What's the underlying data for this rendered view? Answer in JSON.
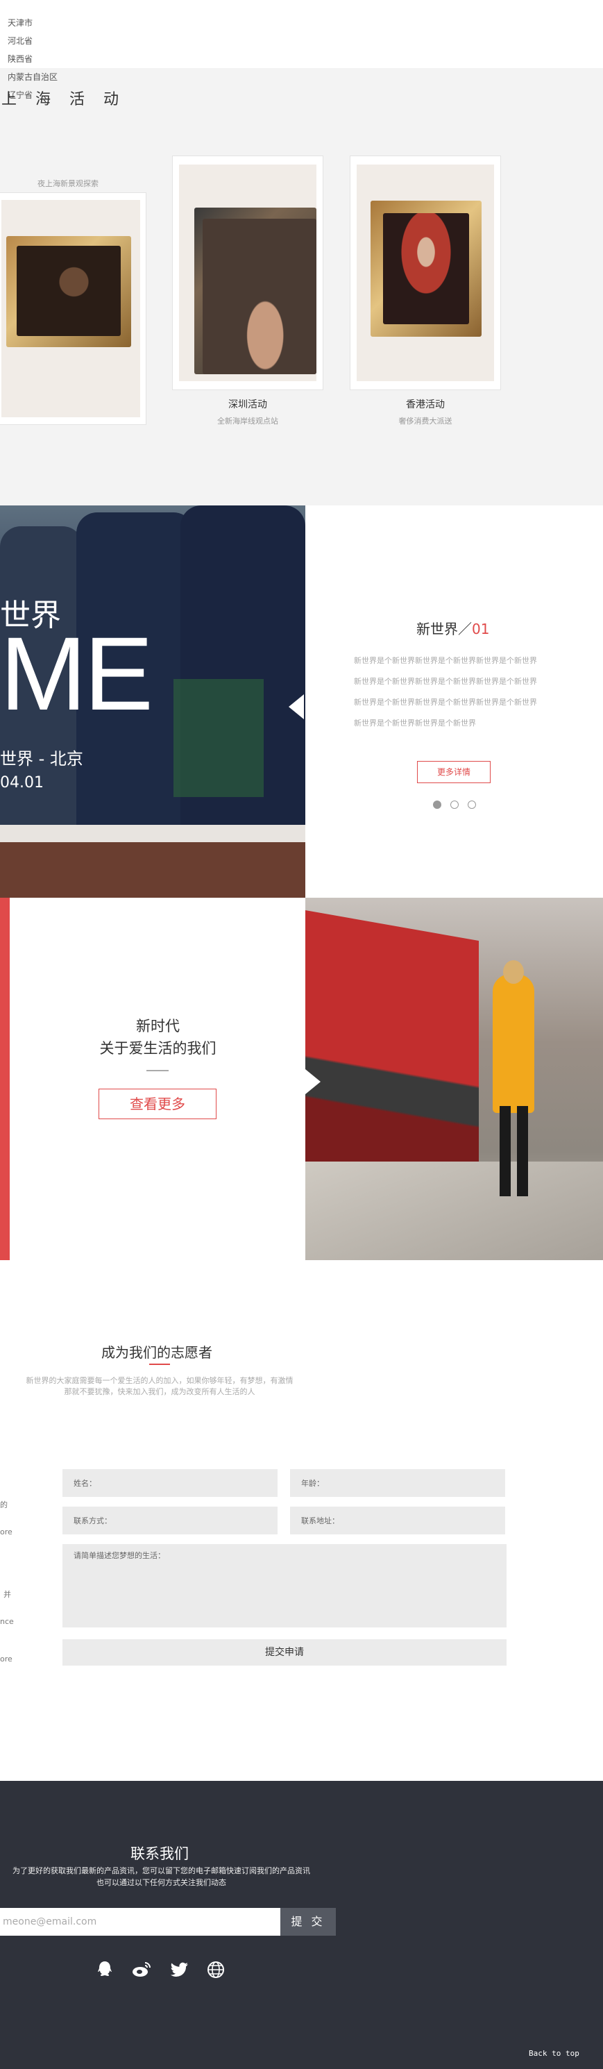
{
  "regions": [
    "天津市",
    "河北省",
    "陕西省",
    "内蒙古自治区",
    "辽宁省"
  ],
  "shanghai": {
    "title": "上海活动",
    "subtitle": "夜上海新景观探索"
  },
  "cards": [
    {
      "title": "深圳活动",
      "subtitle": "全新海岸线观点站"
    },
    {
      "title": "香港活动",
      "subtitle": "奢侈消费大派送"
    }
  ],
  "new_world": {
    "photo_world": "世界",
    "photo_me": "ME",
    "photo_place": "世界 - 北京",
    "photo_date": "04.01",
    "title": "新世界／",
    "title_num": "01",
    "lines": [
      "新世界是个新世界新世界是个新世界新世界是个新世界",
      "新世界是个新世界新世界是个新世界新世界是个新世界",
      "新世界是个新世界新世界是个新世界新世界是个新世界",
      "新世界是个新世界新世界是个新世界"
    ],
    "button": "更多详情",
    "dots": 3,
    "active_dot": 0
  },
  "new_era": {
    "title_line1": "新时代",
    "title_line2": "关于爱生活的我们",
    "button": "查看更多"
  },
  "volunteer": {
    "title": "成为我们的志愿者",
    "desc_line1": "新世界的大家庭需要每一个爱生活的人的加入，如果你够年轻，有梦想，有激情",
    "desc_line2": "那就不要犹豫，快来加入我们，成为改变所有人生活的人",
    "side_texts": [
      "的",
      "ore",
      "并",
      "nce",
      "ore"
    ],
    "fields": {
      "name": "姓名：",
      "age": "年龄：",
      "contact": "联系方式：",
      "address": "联系地址：",
      "dream": "请简单描述您梦想的生活："
    },
    "submit": "提交申请"
  },
  "footer": {
    "title": "联系我们",
    "desc_line1": "为了更好的获取我们最新的产品资讯，您可以留下您的电子邮箱快速订阅我们的产品资讯",
    "desc_line2": "也可以通过以下任何方式关注我们动态",
    "email_placeholder": "meone@email.com",
    "submit": "提 交",
    "icons": [
      "qq-icon",
      "weibo-icon",
      "twitter-icon",
      "globe-icon"
    ],
    "back_to_top": "Back to top"
  },
  "colors": {
    "accent": "#e04a4a",
    "footer_bg": "#2f323b",
    "section_bg": "#f3f3f3"
  }
}
